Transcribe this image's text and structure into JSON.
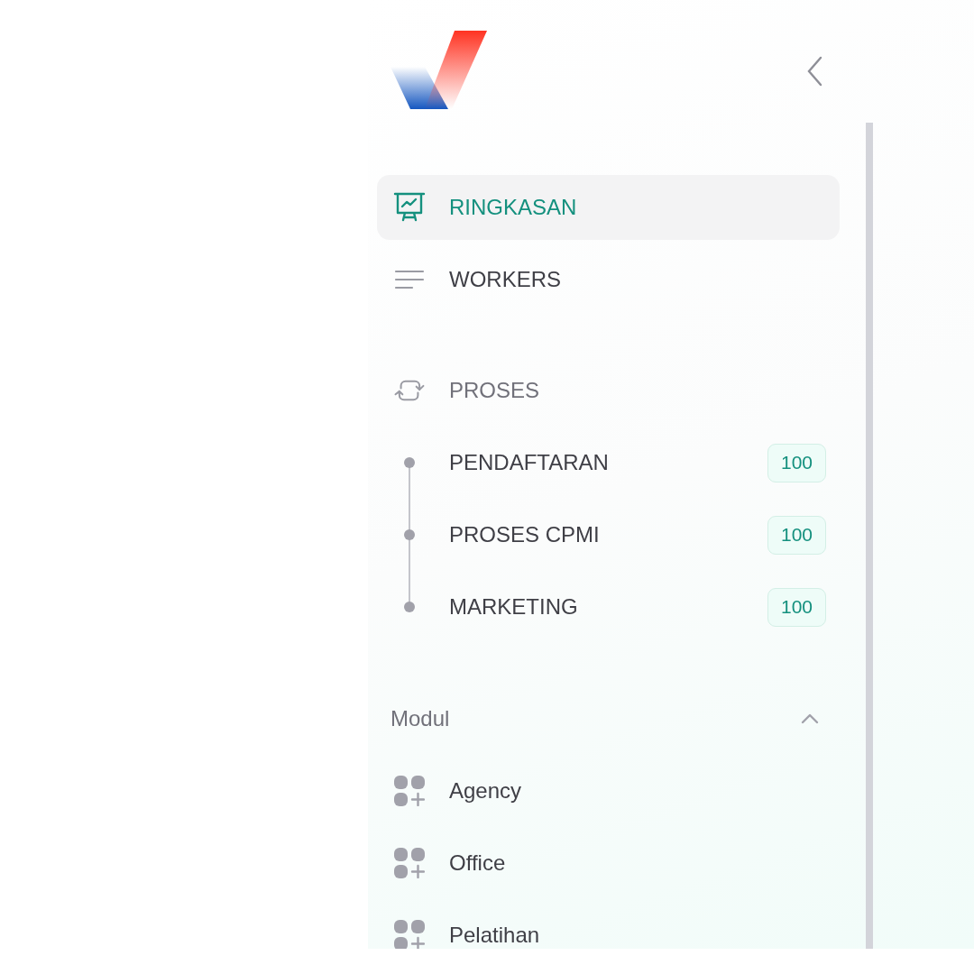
{
  "nav": [
    {
      "label": "RINGKASAN",
      "kind": "link",
      "selected": true
    },
    {
      "label": "WORKERS",
      "kind": "link",
      "selected": false
    },
    {
      "label": "PROSES",
      "kind": "group",
      "selected": false,
      "children": [
        {
          "label": "PENDAFTARAN",
          "badge": "100"
        },
        {
          "label": "PROSES CPMI",
          "badge": "100"
        },
        {
          "label": "MARKETING",
          "badge": "100"
        }
      ]
    }
  ],
  "modul": {
    "title": "Modul",
    "expanded": true,
    "items": [
      {
        "label": "Agency"
      },
      {
        "label": "Office"
      },
      {
        "label": "Pelatihan"
      }
    ]
  }
}
